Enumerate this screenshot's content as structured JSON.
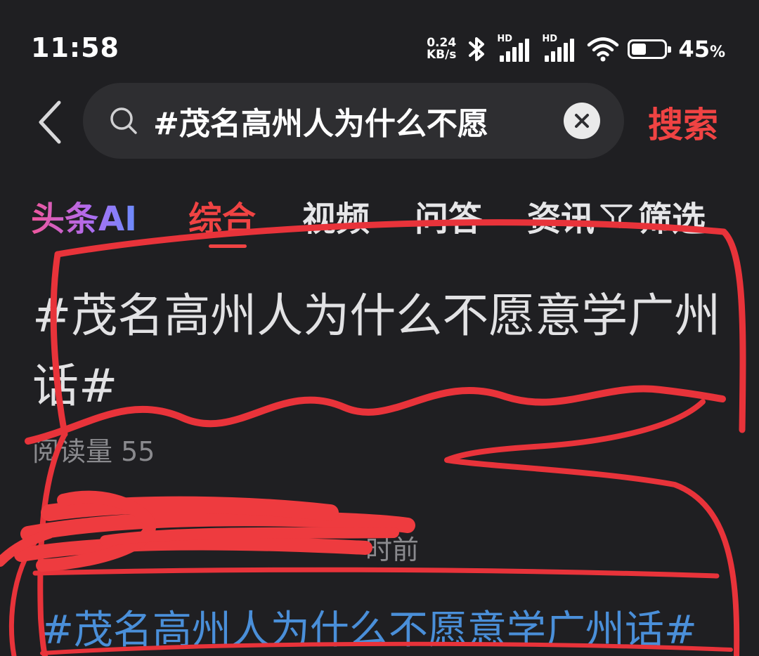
{
  "status_bar": {
    "time": "11:58",
    "net_speed_value": "0.24",
    "net_speed_unit": "KB/s",
    "signal1_label": "HD",
    "signal2_label": "HD",
    "battery_percent": "45",
    "battery_symbol": "%",
    "battery_level": 0.45,
    "icons": [
      "bluetooth-icon",
      "signal-icon",
      "signal-icon",
      "wifi-icon",
      "battery-icon"
    ]
  },
  "search": {
    "query": "#茂名高州人为什么不愿",
    "submit_label": "搜索"
  },
  "tabs": [
    {
      "label": "头条AI"
    },
    {
      "label": "综合",
      "active": true
    },
    {
      "label": "视频"
    },
    {
      "label": "问答"
    },
    {
      "label": "资讯"
    }
  ],
  "filter_label": "筛选",
  "result": {
    "title": "#茂名高州人为什么不愿意学广州话#",
    "read_count": "阅读量 55",
    "time_suffix": "时前",
    "topic": "#茂名高州人为什么不愿意学广州话#"
  },
  "colors": {
    "background": "#1f1f22",
    "accent": "#f04343",
    "link": "#4a8fd9",
    "annotation": "#e8333a"
  }
}
